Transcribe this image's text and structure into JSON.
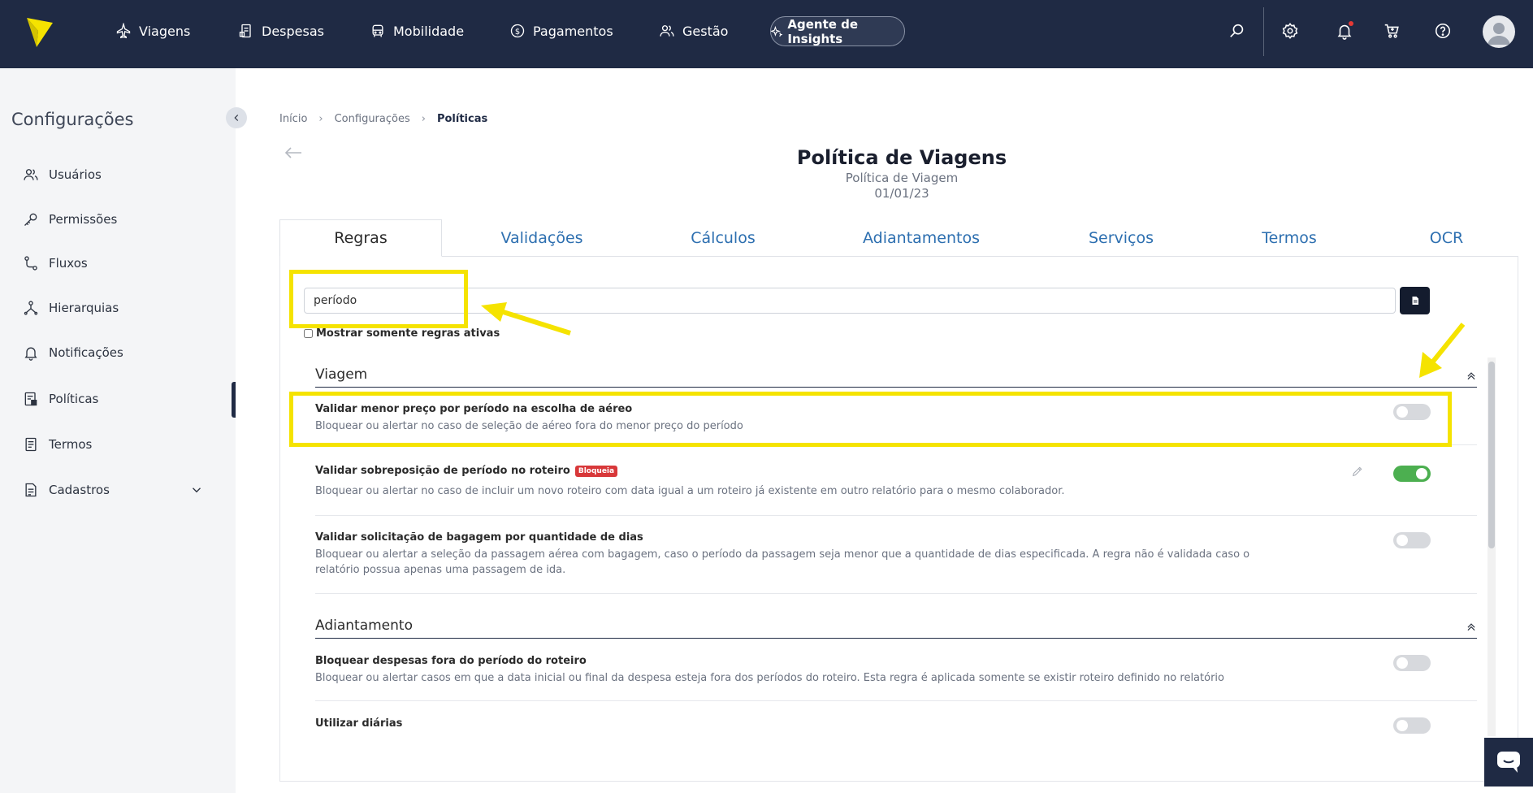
{
  "nav": {
    "items": [
      {
        "label": "Viagens",
        "icon": "plane-icon"
      },
      {
        "label": "Despesas",
        "icon": "receipt-icon"
      },
      {
        "label": "Mobilidade",
        "icon": "car-icon"
      },
      {
        "label": "Pagamentos",
        "icon": "dollar-icon"
      },
      {
        "label": "Gestão",
        "icon": "users-icon"
      }
    ],
    "insights_label": "Agente de Insights",
    "brand_color": "#1f2a44",
    "logo_color": "#f5e300"
  },
  "sidebar": {
    "title": "Configurações",
    "items": [
      {
        "label": "Usuários",
        "icon": "users-icon"
      },
      {
        "label": "Permissões",
        "icon": "key-icon"
      },
      {
        "label": "Fluxos",
        "icon": "flow-icon"
      },
      {
        "label": "Hierarquias",
        "icon": "hierarchy-icon"
      },
      {
        "label": "Notificações",
        "icon": "bell-icon"
      },
      {
        "label": "Políticas",
        "icon": "policy-icon"
      },
      {
        "label": "Termos",
        "icon": "document-icon"
      },
      {
        "label": "Cadastros",
        "icon": "register-icon"
      }
    ],
    "active": "Políticas"
  },
  "breadcrumb": {
    "items": [
      "Início",
      "Configurações",
      "Políticas"
    ]
  },
  "page": {
    "title": "Política de Viagens",
    "subtitle": "Política de Viagem",
    "date": "01/01/23"
  },
  "tabs": [
    "Regras",
    "Validações",
    "Cálculos",
    "Adiantamentos",
    "Serviços",
    "Termos",
    "OCR"
  ],
  "active_tab": "Regras",
  "search": {
    "value": "período",
    "active_only_label": "Mostrar somente regras ativas"
  },
  "sections": [
    {
      "title": "Viagem",
      "rules": [
        {
          "title": "Validar menor preço por período na escolha de aéreo",
          "desc": "Bloquear ou alertar no caso de seleção de aéreo fora do menor preço do período",
          "enabled": false
        },
        {
          "title": "Validar sobreposição de período no roteiro",
          "badge": "Bloqueia",
          "desc": "Bloquear ou alertar no caso de incluir um novo roteiro com data igual a um roteiro já existente em outro relatório para o mesmo colaborador.",
          "enabled": true
        },
        {
          "title": "Validar solicitação de bagagem por quantidade de dias",
          "desc": "Bloquear ou alertar a seleção da passagem aérea com bagagem, caso o período da passagem seja menor que a quantidade de dias especificada. A regra não é validada caso o relatório possua apenas uma passagem de ida.",
          "enabled": false
        }
      ]
    },
    {
      "title": "Adiantamento",
      "rules": [
        {
          "title": "Bloquear despesas fora do período do roteiro",
          "desc": "Bloquear ou alertar casos em que a data inicial ou final da despesa esteja fora dos períodos do roteiro. Esta regra é aplicada somente se existir roteiro definido no relatório",
          "enabled": false
        },
        {
          "title": "Utilizar diárias",
          "desc": "",
          "enabled": false
        }
      ]
    }
  ],
  "colors": {
    "toggle_on": "#4caf50",
    "badge": "#d8383a",
    "highlight": "#f5e300",
    "tab_link": "#2d6fb0"
  }
}
